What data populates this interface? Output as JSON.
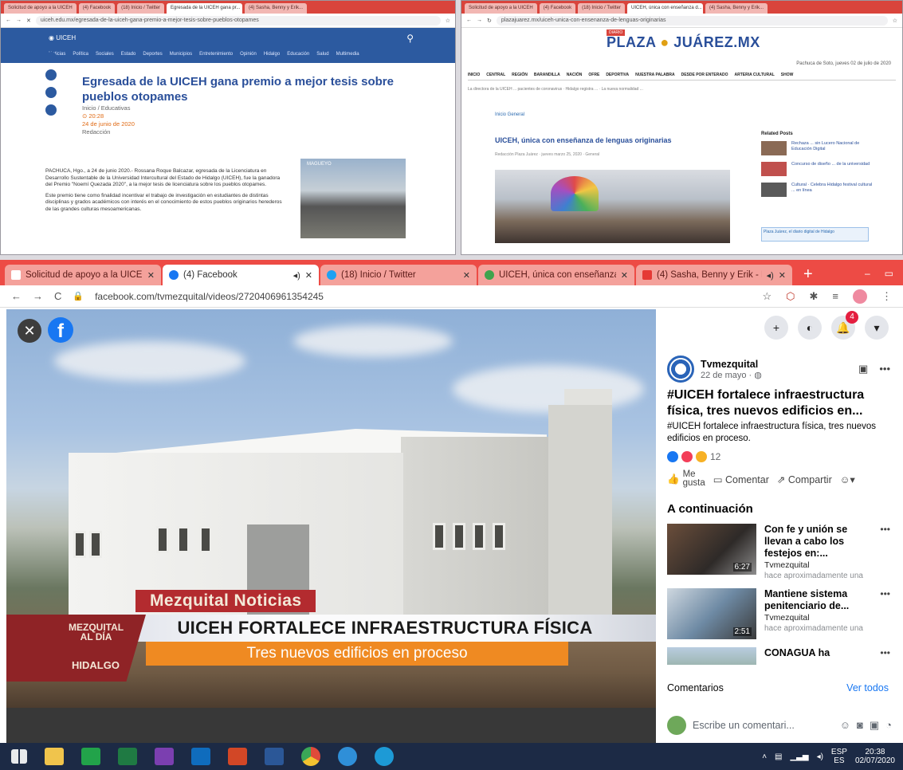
{
  "top_left": {
    "tabs": [
      "Solicitud de apoyo a la UICEH",
      "(4) Facebook",
      "(18) Inicio / Twitter",
      "Egresada de la UICEH gana pr...",
      "(4) Sasha, Benny y Erik..."
    ],
    "url": "uiceh.edu.mx/egresada-de-la-uiceh-gana-premio-a-mejor-tesis-sobre-pueblos-otopames",
    "nav": [
      "Noticias",
      "Política",
      "Sociales",
      "Estado",
      "Deportes",
      "Municipios",
      "Entretenimiento",
      "Opinión",
      "Hidalgo",
      "Educación",
      "Salud",
      "Multimedia"
    ],
    "title": "Egresada de la UICEH gana premio a mejor tesis sobre pueblos otopames",
    "category": "Inicio / Educativas",
    "time": "20:28",
    "date": "24 de junio de 2020",
    "by": "Redacción",
    "body_1": "PACHUCA, Hgo., a 24 de junio 2020.- Rossana Roque Balcazar, egresada de la Licenciatura en Desarrollo Sustentable de la Universidad Intercultural del Estado de Hidalgo (UICEH), fue la ganadora del Premio \"Noemí Quezada 2020\", a la mejor tesis de licenciatura sobre los pueblos otopames.",
    "body_2": "Este premio tiene como finalidad incentivar el trabajo de investigación en estudiantes de distintas disciplinas y grados académicos con interés en el conocimiento de estos pueblos originarios herederos de las grandes culturas mesoamericanas.",
    "image_label": "MAGUEYO"
  },
  "top_right": {
    "tabs": [
      "Solicitud de apoyo a la UICEH",
      "(4) Facebook",
      "(18) Inicio / Twitter",
      "UICEH, única con enseñanza d...",
      "(4) Sasha, Benny y Erik..."
    ],
    "url": "plazajuarez.mx/uiceh-unica-con-ensenanza-de-lenguas-originarias",
    "badge": "DIARIO",
    "logo_a": "PLAZA",
    "logo_b": "JUÁREZ.MX",
    "date": "Pachuca de Soto, jueves 02 de julio de 2020",
    "nav": [
      "INICIO",
      "CENTRAL",
      "REGIÓN",
      "BARANDILLA",
      "NACIÓN",
      "OFRE",
      "DEPORTIVA",
      "NUESTRA PALABRA",
      "DESDE POR ENTERADO",
      "ARTERIA CULTURAL",
      "SHOW"
    ],
    "ticker": "La directora de la UICEH ... pacientes de coronavirus · Hidalgo registra ... · La nueva normalidad ...",
    "crumb": "Inicio   General",
    "title": "UICEH, única con enseñanza de lenguas originarias",
    "byline": "Redacción Plaza Juárez · jueves marzo 25, 2020 · General",
    "side_head": "Related Posts",
    "side": [
      "Rechaza ... sin Lucero Nacional de Educación Digital",
      "Concurso de diseño ... de la universidad",
      "Cultural · Celebra Hidalgo festival cultural ... en línea"
    ],
    "ad": "Plaza Juárez, el diario digital de Hidalgo"
  },
  "main": {
    "tabs": [
      {
        "label": "Solicitud de apoyo a la UICEH",
        "color": "#d9443c"
      },
      {
        "label": "(4) Facebook",
        "color": "#1877f2"
      },
      {
        "label": "(18) Inicio / Twitter",
        "color": "#1da1f2"
      },
      {
        "label": "UICEH, única con enseñanza de",
        "color": "#3fa34d"
      },
      {
        "label": "(4) Sasha, Benny y Erik - N",
        "color": "#e53935"
      }
    ],
    "url": "facebook.com/tvmezquital/videos/272040696135424​5",
    "video": {
      "label": "Mezquital Noticias",
      "headline": "UICEH FORTALECE INFRAESTRUCTURA FÍSICA",
      "subhead": "Tres nuevos edificios en proceso",
      "side_l1": "MEZQUITAL",
      "side_l2": "AL DÍA",
      "side_l3": "HIDALGO"
    },
    "notif_count": "4",
    "post": {
      "page_name": "Tvmezquital",
      "date": "22 de mayo",
      "title": "#UICEH fortalece infraestructura física, tres nuevos edificios en...",
      "desc": "#UICEH fortalece infraestructura física, tres nuevos edificios en proceso.",
      "reactions": "12",
      "like_1": "Me",
      "like_2": "gusta",
      "comment": "Comentar",
      "share": "Compartir"
    },
    "next_heading": "A continuación",
    "next": [
      {
        "title": "Con fe y unión se llevan a cabo los festejos en:...",
        "channel": "Tvmezquital",
        "time": "hace aproximadamente una",
        "duration": "6:27"
      },
      {
        "title": "Mantiene sistema penitenciario de...",
        "channel": "Tvmezquital",
        "time": "hace aproximadamente una",
        "duration": "2:51"
      },
      {
        "title": "CONAGUA ha",
        "channel": "",
        "time": "",
        "duration": ""
      }
    ],
    "comments_label": "Comentarios",
    "see_all": "Ver todos",
    "comment_placeholder": "Escribe un comentari..."
  },
  "taskbar": {
    "lang_1": "ESP",
    "lang_2": "ES",
    "time": "20:38",
    "date": "02/07/2020"
  }
}
